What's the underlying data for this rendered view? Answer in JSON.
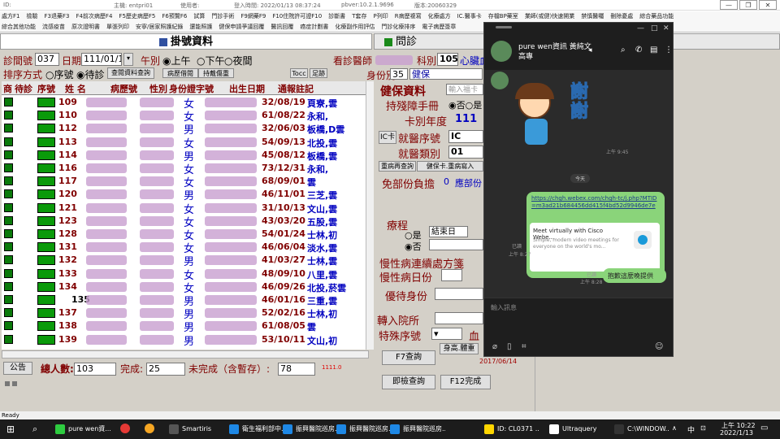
{
  "titlebar": {
    "id": "ID:",
    "host": "主機: entpri01",
    "user": "使用者:",
    "login": "登入時間: 2022/01/13 08:37:24",
    "pbver": "pbver:10.2.1.9696",
    "ver": "版本:20060329"
  },
  "menu1": [
    "處方F1",
    "檢驗",
    "F3退藥F3",
    "F4前次病歷F4",
    "F5歷史病歷F5",
    "F6預覽F6",
    "試算",
    "門診手術",
    "F9網藥F9",
    "F10住院許可證F10",
    "診斷書",
    "T套存",
    "P列印",
    "R病歷複寫",
    "化療處方",
    "IC.醫事卡",
    "存檔BP藥室",
    "業師(或健)快速開業",
    "禁慎醫囑",
    "刪除憂處",
    "綜合藥品功能"
  ],
  "menu2": [
    "綜合其他功能",
    "流感疫苗",
    "原次證明書",
    "單張列印",
    "安寧/居家照護紀錄",
    "還能照護",
    "健保申請爭議回覆",
    "醫訊回覆",
    "癌症計劃書",
    "化療副作用評估",
    "門診化療排序",
    "電子病歷簽章"
  ],
  "left_header": "掛號資料",
  "right_header": "問診",
  "form": {
    "reg_label": "診間號",
    "reg_value": "037",
    "date_label": "日期",
    "date_value": "111/01/13",
    "ampm_label": "午別",
    "am": "上午",
    "pm": "下午",
    "night": "夜間",
    "doctor_label": "看診醫師",
    "dept_label": "科別",
    "dept_value": "1050",
    "dept_name": "心臟血",
    "sort_label": "排序方式",
    "sort_seq": "序號",
    "sort_wait": "待診",
    "btn_query": "查閱資料查詢",
    "btn_tocc": "Tocc",
    "btn_foot": "足跡",
    "btn_history": "病歷借閱",
    "btn_wait": "持戴傷重",
    "id_type_label": "身份別",
    "id_type_value": "35",
    "id_type_name": "健保"
  },
  "columns": [
    "商",
    "待診",
    "序號",
    "姓 名",
    "病歷號",
    "性別",
    "身份證字號",
    "出生日期",
    "通報註記"
  ],
  "rows": [
    {
      "seq": "109",
      "sex": "女",
      "dob": "32/08/19",
      "note": "頁寮,雲"
    },
    {
      "seq": "110",
      "sex": "女",
      "dob": "61/08/22",
      "note": "永和,"
    },
    {
      "seq": "112",
      "sex": "男",
      "dob": "32/06/03",
      "note": "板橋,D雲"
    },
    {
      "seq": "113",
      "sex": "女",
      "dob": "54/09/13",
      "note": "北投,雲"
    },
    {
      "seq": "114",
      "sex": "男",
      "dob": "45/08/12",
      "note": "板橋,雲"
    },
    {
      "seq": "116",
      "sex": "女",
      "dob": "73/12/31",
      "note": "永和,"
    },
    {
      "seq": "117",
      "sex": "女",
      "dob": "68/09/01",
      "note": "雲"
    },
    {
      "seq": "120",
      "sex": "男",
      "dob": "46/11/01",
      "note": "三芝,雲"
    },
    {
      "seq": "121",
      "sex": "女",
      "dob": "31/10/13",
      "note": "文山,雲"
    },
    {
      "seq": "123",
      "sex": "女",
      "dob": "43/03/20",
      "note": "五股,雲"
    },
    {
      "seq": "128",
      "sex": "女",
      "dob": "54/01/24",
      "note": "士林,初"
    },
    {
      "seq": "131",
      "sex": "女",
      "dob": "46/06/04",
      "note": "淡水,雲"
    },
    {
      "seq": "132",
      "sex": "男",
      "dob": "41/03/27",
      "note": "士林,雲"
    },
    {
      "seq": "133",
      "sex": "女",
      "dob": "48/09/10",
      "note": "八里,雲"
    },
    {
      "seq": "134",
      "sex": "女",
      "dob": "46/09/26",
      "note": "北投,菸雲"
    },
    {
      "seq": "135",
      "sex": "男",
      "dob": "46/01/16",
      "note": "三重,雲"
    },
    {
      "seq": "137",
      "sex": "男",
      "dob": "52/02/16",
      "note": "士林,初"
    },
    {
      "seq": "138",
      "sex": "男",
      "dob": "61/08/05",
      "note": "雲"
    },
    {
      "seq": "139",
      "sex": "男",
      "dob": "53/10/11",
      "note": "文山,初"
    }
  ],
  "bottom": {
    "notice": "公告",
    "total_label": "總人數:",
    "total": "103",
    "done_label": "完成:",
    "done": "25",
    "undone_label": "未完成（含暫存）:",
    "undone": "78",
    "red_num": "1111.0"
  },
  "right": {
    "nhi_title": "健保資料",
    "card_label": "持殘障手冊",
    "no": "否",
    "yes": "是",
    "card_year_label": "卡別年度",
    "card_year": "111",
    "ic_label": "IC卡",
    "med_seq_label": "就醫序號",
    "med_seq": "IC",
    "med_type_label": "就醫類別",
    "med_type": "01",
    "btn_redo": "重病再查詢",
    "btn_nhi": "健保卡.重病寫入",
    "exempt_label": "免部份負擔",
    "exempt_value": "0",
    "exempt_btn": "應部份",
    "course_label": "療程",
    "course_end": "結束日",
    "chronic_label": "慢性病連續處方箋",
    "chronic_days_label": "慢性病日份",
    "priority_label": "優待身份",
    "transfer_label": "轉入院所",
    "special_label": "特殊序號",
    "blood_label": "血",
    "btn_f7": "F7查詢",
    "btn_height": "身高.體重",
    "btn_check": "即檢查詢",
    "btn_f12": "F12完成",
    "date_red": "2017/06/14",
    "input_placeholder": "輸入福卡"
  },
  "chat": {
    "name": "pure wen資訊 黃純文 高專",
    "sticker_text": "謝謝",
    "time1": "上午 9:45",
    "today": "今天",
    "link": "https://chgh.webex.com/chgh-tc/j.php?MTID=m3ad21b684456dd415f4bd52d9946de7e",
    "preview_title": "Meet virtually with Cisco Webe...",
    "preview_desc": "Simple, modern video meetings for everyone on the world's mo...",
    "read1": "已讀",
    "time2": "上午 8:27",
    "reply": "抱歉這麼晚提供",
    "read2": "已讀",
    "time3": "上午 8:28",
    "input_placeholder": "輸入訊息"
  },
  "taskbar": {
    "items": [
      "pure wen資...",
      "Smartiris",
      "衛生福利部中...",
      "振興醫院巡房...",
      "振興醫院巡房...",
      "振興醫院巡房...",
      "ID: CL0371 ...",
      "Ultraquery",
      "C:\\WINDOW..."
    ],
    "ime": "中",
    "time": "上午 10:22",
    "date": "2022/1/13"
  },
  "status": "Ready"
}
